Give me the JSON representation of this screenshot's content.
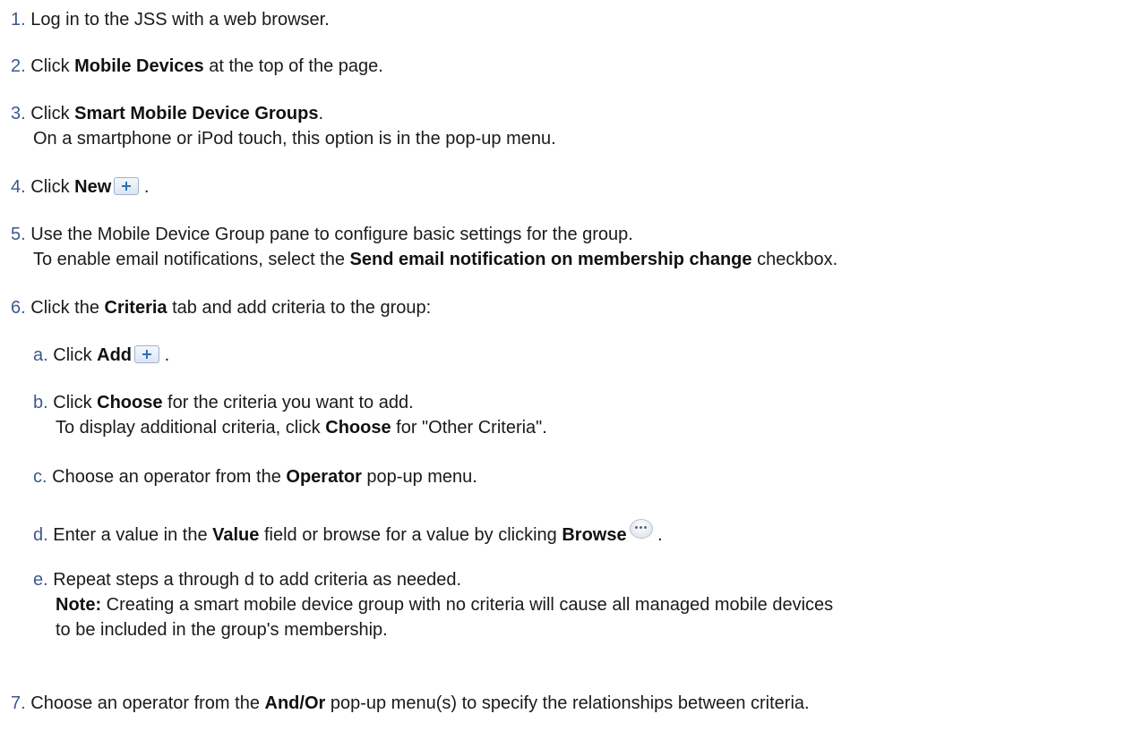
{
  "steps": [
    {
      "num": "1.",
      "pre": "Log in to the JSS with a web browser.",
      "bold": "",
      "post": ""
    },
    {
      "num": "2.",
      "pre": "Click ",
      "bold": "Mobile Devices",
      "post": " at the top of the page."
    },
    {
      "num": "3.",
      "pre": "Click ",
      "bold": "Smart Mobile Device Groups",
      "post": ".",
      "line2": "On a smartphone or iPod touch, this option is in the pop-up menu."
    },
    {
      "num": "4.",
      "pre": "Click ",
      "bold": "New",
      "post": " ."
    },
    {
      "num": "5.",
      "pre": "Use the Mobile Device Group pane to configure basic settings for the group.",
      "line2_pre": "To enable email notifications, select the ",
      "line2_bold": "Send email notification on membership change",
      "line2_post": " checkbox."
    },
    {
      "num": "6.",
      "pre": "Click the ",
      "bold": "Criteria",
      "post": " tab and add criteria to the group:"
    },
    {
      "num": "7.",
      "pre": "Choose an operator from the ",
      "bold": "And/Or",
      "post": " pop-up menu(s) to specify the relationships between criteria."
    }
  ],
  "substeps": [
    {
      "num": "a.",
      "pre": "Click ",
      "bold": "Add",
      "post": " ."
    },
    {
      "num": "b.",
      "pre": "Click ",
      "bold": "Choose",
      "post": " for the criteria you want to add.",
      "line2_pre": "To display additional criteria, click ",
      "line2_bold": "Choose",
      "line2_post": " for \"Other Criteria\"."
    },
    {
      "num": "c.",
      "pre": "Choose an operator from the ",
      "bold": "Operator",
      "post": " pop-up menu."
    },
    {
      "num": "d.",
      "pre": "Enter a value in the ",
      "bold": "Value",
      "post": " field or browse for a value by clicking ",
      "bold2": "Browse",
      "post2": " ."
    },
    {
      "num": "e.",
      "pre": "Repeat steps a through d to add criteria as needed.",
      "line2_bold": "Note:",
      "line2_post": " Creating a smart mobile device group with no criteria will cause all managed mobile devices",
      "line3": "to be included in the group's membership."
    }
  ],
  "icons": {
    "add": "plus-icon",
    "browse": "browse-icon"
  }
}
